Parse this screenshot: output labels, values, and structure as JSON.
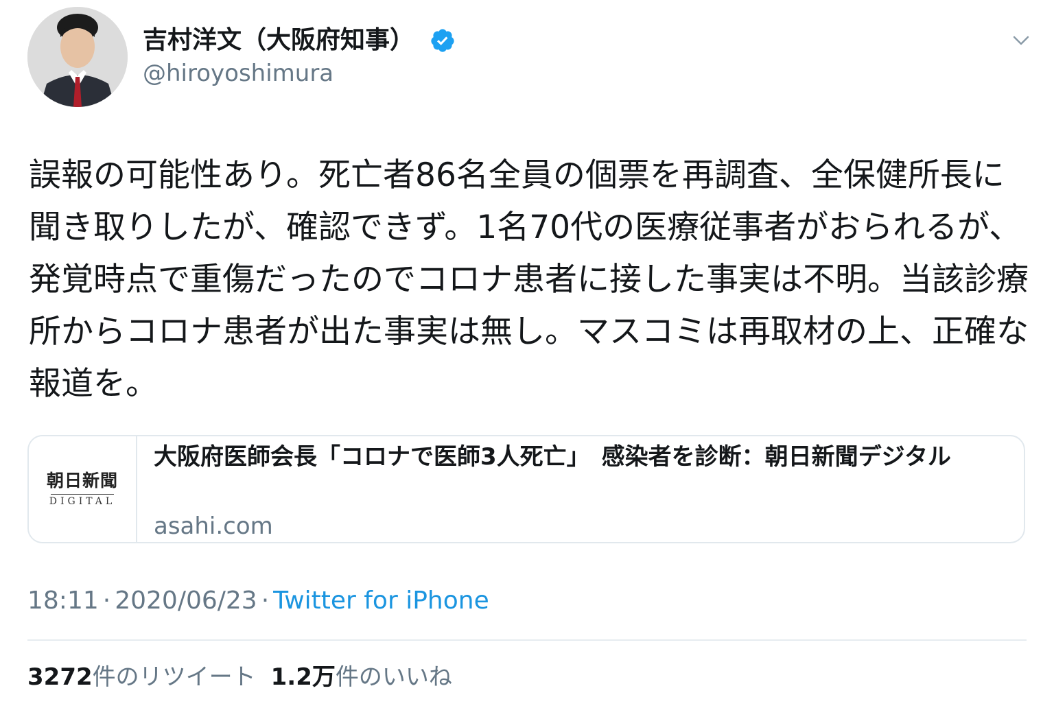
{
  "author": {
    "display_name": "吉村洋文（大阪府知事）",
    "handle": "@hiroyoshimura",
    "verified": true,
    "verified_icon": "verified-badge-icon",
    "avatar": "profile-photo"
  },
  "menu": {
    "icon": "chevron-down-icon"
  },
  "tweet": {
    "text": "誤報の可能性あり。死亡者86名全員の個票を再調査、全保健所長に聞き取りしたが、確認できず。1名70代の医療従事者がおられるが、発覚時点で重傷だったのでコロナ患者に接した事実は不明。当該診療所からコロナ患者が出た事実は無し。マスコミは再取材の上、正確な報道を。"
  },
  "link_card": {
    "logo_main": "朝日新聞",
    "logo_sub": "DIGITAL",
    "title": "大阪府医師会長「コロナで医師3人死亡」　感染者を診断：朝日新聞デジタル",
    "domain": "asahi.com"
  },
  "meta": {
    "time": "18:11",
    "date": "2020/06/23",
    "separator": "·",
    "source": "Twitter for iPhone"
  },
  "stats": {
    "retweets_count": "3272",
    "retweets_label": "件のリツイート",
    "likes_count": "1.2万",
    "likes_label": "件のいいね"
  },
  "colors": {
    "text": "#14171a",
    "secondary": "#657786",
    "link": "#1b95e0",
    "verified": "#1da1f2",
    "border": "#e1e8ed"
  }
}
